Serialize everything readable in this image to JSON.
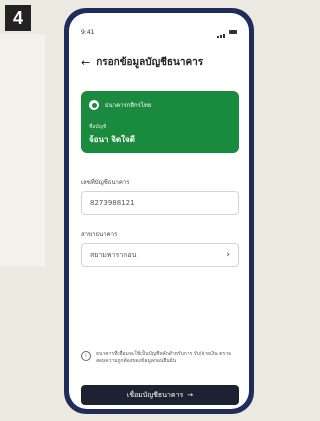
{
  "step": "4",
  "status_bar": {
    "time": "9:41"
  },
  "header": {
    "back_icon": "←",
    "title": "กรอกข้อมูลบัญชีธนาคาร"
  },
  "bank_card": {
    "bank_name": "ธนาคารกสิกรไทย",
    "account_label": "ชื่อบัญชี",
    "account_name": "จ้อนา จิตใจดี",
    "color": "#1a8a3e"
  },
  "account_number": {
    "label": "เลขที่บัญชีธนาคาร",
    "value": "8273988121"
  },
  "branch": {
    "label": "สาขาธนาคาร",
    "value": "สยามพารากอน",
    "chevron": "›"
  },
  "info": {
    "icon": "i",
    "text": "ธนาคารที่เชื่อมจะใช้เป็นบัญชีหลักสำหรับการ รับ/จ่ายเงิน ตรวจสอบความถูกต้องของข้อมูลก่อนยืนยัน"
  },
  "cta": {
    "label": "เชื่อมบัญชีธนาคาร",
    "arrow": "→"
  }
}
